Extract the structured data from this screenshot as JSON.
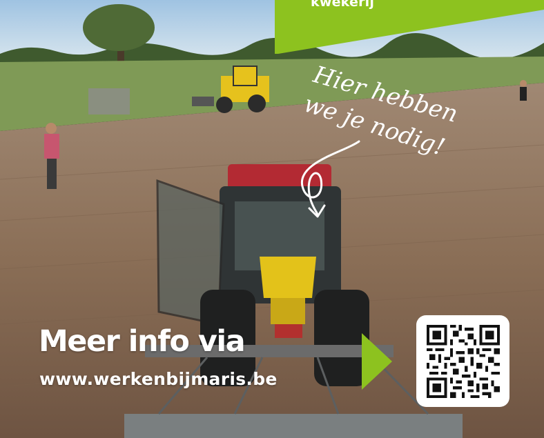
{
  "banner": {
    "tab_text": "kwekerij",
    "headline": "Meer info via",
    "url": "www.werkenbijmaris.be",
    "handwritten_line1": "Hier hebben",
    "handwritten_line2": "we je nodig!"
  },
  "colors": {
    "accent_green": "#8dc21f",
    "text": "#ffffff",
    "soil": "#8a6e56"
  },
  "icons": {
    "arrow": "play-triangle-icon",
    "qr": "qr-code-icon"
  }
}
